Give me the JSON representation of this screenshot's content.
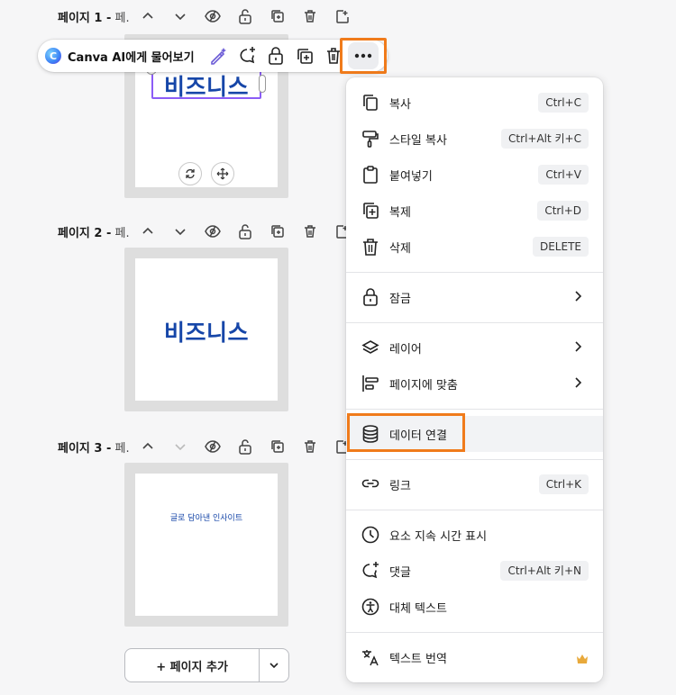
{
  "pages": [
    {
      "label": "페이지 1 -",
      "sub": " 페."
    },
    {
      "label": "페이지 2 -",
      "sub": " 페."
    },
    {
      "label": "페이지 3 -",
      "sub": " 페."
    }
  ],
  "canvas": {
    "page1_text": "비즈니스",
    "page2_text": "비즈니스",
    "page3_text": "글로 담아낸 인사이트"
  },
  "toolbar": {
    "ai_logo": "C",
    "ai_label": "Canva AI에게 물어보기"
  },
  "menu": {
    "copy": {
      "label": "복사",
      "shortcut": "Ctrl+C"
    },
    "copy_style": {
      "label": "스타일 복사",
      "shortcut": "Ctrl+Alt 키+C"
    },
    "paste": {
      "label": "붙여넣기",
      "shortcut": "Ctrl+V"
    },
    "duplicate": {
      "label": "복제",
      "shortcut": "Ctrl+D"
    },
    "delete": {
      "label": "삭제",
      "shortcut": "DELETE"
    },
    "lock": {
      "label": "잠금"
    },
    "layer": {
      "label": "레이어"
    },
    "align_page": {
      "label": "페이지에 맞춤"
    },
    "connect_data": {
      "label": "데이터 연결"
    },
    "link": {
      "label": "링크",
      "shortcut": "Ctrl+K"
    },
    "show_timing": {
      "label": "요소 지속 시간 표시"
    },
    "comment": {
      "label": "댓글",
      "shortcut": "Ctrl+Alt 키+N"
    },
    "alt_text": {
      "label": "대체 텍스트"
    },
    "translate": {
      "label": "텍스트 번역"
    }
  },
  "add_page": {
    "label": "+ 페이지 추가"
  },
  "colors": {
    "accent_outline": "#f07b1b",
    "brand_text": "#1646a8",
    "selection": "#8b5cf6",
    "crown": "#e8a93b"
  }
}
